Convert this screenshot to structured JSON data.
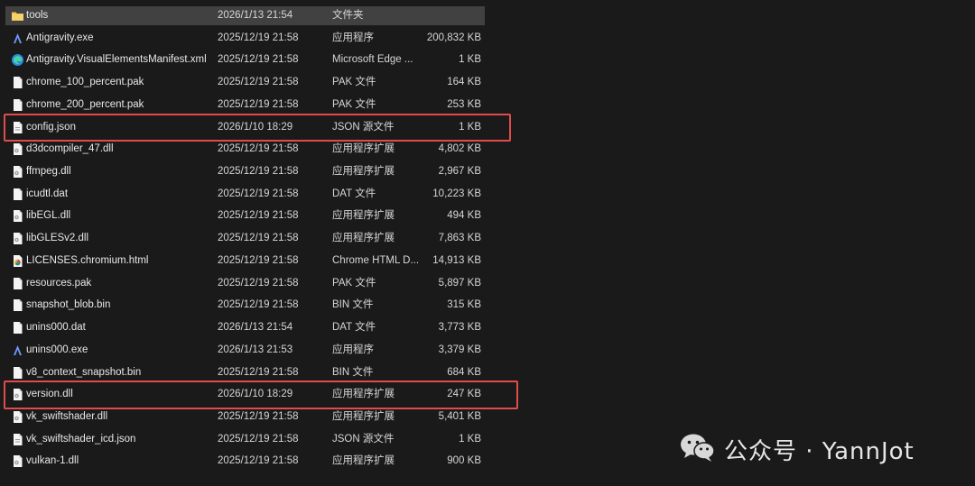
{
  "files": [
    {
      "name": "tools",
      "date": "2026/1/13 21:54",
      "type": "文件夹",
      "size": "",
      "icon": "folder-icon"
    },
    {
      "name": "Antigravity.exe",
      "date": "2025/12/19 21:58",
      "type": "应用程序",
      "size": "200,832 KB",
      "icon": "antigravity-app-icon"
    },
    {
      "name": "Antigravity.VisualElementsManifest.xml",
      "date": "2025/12/19 21:58",
      "type": "Microsoft Edge ...",
      "size": "1 KB",
      "icon": "edge-icon"
    },
    {
      "name": "chrome_100_percent.pak",
      "date": "2025/12/19 21:58",
      "type": "PAK 文件",
      "size": "164 KB",
      "icon": "file-icon"
    },
    {
      "name": "chrome_200_percent.pak",
      "date": "2025/12/19 21:58",
      "type": "PAK 文件",
      "size": "253 KB",
      "icon": "file-icon"
    },
    {
      "name": "config.json",
      "date": "2026/1/10 18:29",
      "type": "JSON 源文件",
      "size": "1 KB",
      "icon": "json-file-icon"
    },
    {
      "name": "d3dcompiler_47.dll",
      "date": "2025/12/19 21:58",
      "type": "应用程序扩展",
      "size": "4,802 KB",
      "icon": "dll-file-icon"
    },
    {
      "name": "ffmpeg.dll",
      "date": "2025/12/19 21:58",
      "type": "应用程序扩展",
      "size": "2,967 KB",
      "icon": "dll-file-icon"
    },
    {
      "name": "icudtl.dat",
      "date": "2025/12/19 21:58",
      "type": "DAT 文件",
      "size": "10,223 KB",
      "icon": "file-icon"
    },
    {
      "name": "libEGL.dll",
      "date": "2025/12/19 21:58",
      "type": "应用程序扩展",
      "size": "494 KB",
      "icon": "dll-file-icon"
    },
    {
      "name": "libGLESv2.dll",
      "date": "2025/12/19 21:58",
      "type": "应用程序扩展",
      "size": "7,863 KB",
      "icon": "dll-file-icon"
    },
    {
      "name": "LICENSES.chromium.html",
      "date": "2025/12/19 21:58",
      "type": "Chrome HTML D...",
      "size": "14,913 KB",
      "icon": "chrome-html-icon"
    },
    {
      "name": "resources.pak",
      "date": "2025/12/19 21:58",
      "type": "PAK 文件",
      "size": "5,897 KB",
      "icon": "file-icon"
    },
    {
      "name": "snapshot_blob.bin",
      "date": "2025/12/19 21:58",
      "type": "BIN 文件",
      "size": "315 KB",
      "icon": "file-icon"
    },
    {
      "name": "unins000.dat",
      "date": "2026/1/13 21:54",
      "type": "DAT 文件",
      "size": "3,773 KB",
      "icon": "file-icon"
    },
    {
      "name": "unins000.exe",
      "date": "2026/1/13 21:53",
      "type": "应用程序",
      "size": "3,379 KB",
      "icon": "antigravity-app-icon"
    },
    {
      "name": "v8_context_snapshot.bin",
      "date": "2025/12/19 21:58",
      "type": "BIN 文件",
      "size": "684 KB",
      "icon": "file-icon"
    },
    {
      "name": "version.dll",
      "date": "2026/1/10 18:29",
      "type": "应用程序扩展",
      "size": "247 KB",
      "icon": "dll-file-icon"
    },
    {
      "name": "vk_swiftshader.dll",
      "date": "2025/12/19 21:58",
      "type": "应用程序扩展",
      "size": "5,401 KB",
      "icon": "dll-file-icon"
    },
    {
      "name": "vk_swiftshader_icd.json",
      "date": "2025/12/19 21:58",
      "type": "JSON 源文件",
      "size": "1 KB",
      "icon": "json-file-icon"
    },
    {
      "name": "vulkan-1.dll",
      "date": "2025/12/19 21:58",
      "type": "应用程序扩展",
      "size": "900 KB",
      "icon": "dll-file-icon"
    }
  ],
  "selected_row": "tools",
  "highlighted_files": [
    "config.json",
    "version.dll"
  ],
  "watermark": {
    "text": "公众号 · YannJot",
    "icon": "wechat-logo-icon"
  },
  "colors": {
    "background": "#1a1a1a",
    "selection": "#414141",
    "highlight": "#e04b4b",
    "folder": "#f3c34c"
  }
}
